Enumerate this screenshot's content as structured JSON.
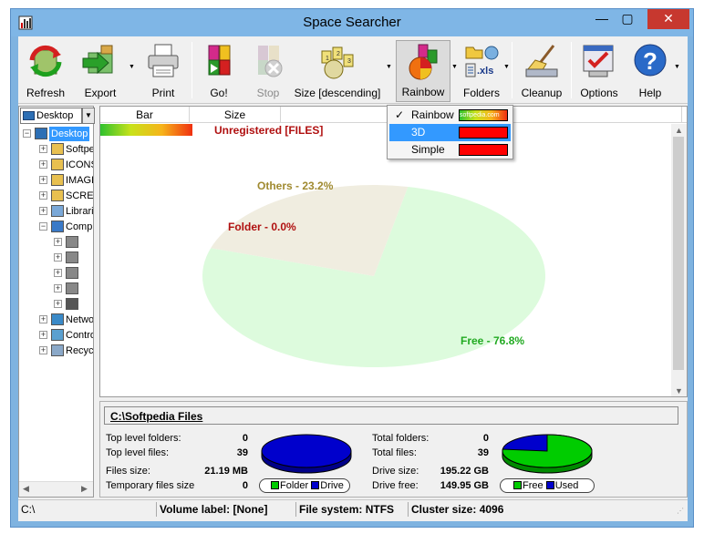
{
  "window": {
    "title": "Space Searcher"
  },
  "window_buttons": {
    "minimize": "—",
    "maximize": "▢",
    "close": "✕"
  },
  "toolbar": {
    "refresh": "Refresh",
    "export": "Export",
    "print": "Print",
    "go": "Go!",
    "stop": "Stop",
    "size": "Size [descending]",
    "rainbow": "Rainbow",
    "folders": "Folders",
    "cleanup": "Cleanup",
    "options": "Options",
    "help": "Help",
    "folders_icon_text": ".xls"
  },
  "left": {
    "drive_combo": "Desktop",
    "tree": [
      {
        "label": "Desktop",
        "indent": 0,
        "selected": true,
        "expander": "−"
      },
      {
        "label": "Softpedia",
        "indent": 1,
        "expander": "+"
      },
      {
        "label": "ICONS",
        "indent": 1,
        "expander": "+"
      },
      {
        "label": "IMAGES",
        "indent": 1,
        "expander": "+"
      },
      {
        "label": "SCREENSHOTS",
        "indent": 1,
        "expander": "+"
      },
      {
        "label": "Libraries",
        "indent": 1,
        "expander": "+"
      },
      {
        "label": "Computer",
        "indent": 1,
        "expander": "−"
      },
      {
        "label": "",
        "indent": 2,
        "expander": "+"
      },
      {
        "label": "",
        "indent": 2,
        "expander": "+"
      },
      {
        "label": "",
        "indent": 2,
        "expander": "+"
      },
      {
        "label": "",
        "indent": 2,
        "expander": "+"
      },
      {
        "label": "",
        "indent": 2,
        "expander": "+"
      },
      {
        "label": "Network",
        "indent": 1,
        "expander": "+"
      },
      {
        "label": "Control Panel",
        "indent": 1,
        "expander": "+"
      },
      {
        "label": "Recycle Bin",
        "indent": 1,
        "expander": "+"
      }
    ]
  },
  "columns": {
    "bar": "Bar",
    "size": "Size"
  },
  "unregistered": "Unregistered [FILES]",
  "pie": {
    "slices": [
      {
        "label": "Free - 76.8%",
        "value": 76.8,
        "color": "#ddfbdd",
        "text_color": "#22aa22"
      },
      {
        "label": "Others - 23.2%",
        "value": 23.2,
        "color": "#f0ede0",
        "text_color": "#a08a30"
      },
      {
        "label": "Folder - 0.0%",
        "value": 0.0,
        "color": "#b01010",
        "text_color": "#b01010"
      }
    ]
  },
  "menu": {
    "items": [
      {
        "label": "Rainbow",
        "checked": true,
        "check_glyph": "✓"
      },
      {
        "label": "3D",
        "checked": false,
        "highlighted": true
      },
      {
        "label": "Simple",
        "checked": false
      }
    ],
    "rainbow_swatch_text": "softpedia.com"
  },
  "details": {
    "path": "C:\\Softpedia Files",
    "left_stats": [
      {
        "label": "Top level folders:",
        "value": "0"
      },
      {
        "label": "Top level files:",
        "value": "39"
      },
      {
        "label": "Files size:",
        "value": "21.19 MB"
      },
      {
        "label": "Temporary files size",
        "value": "0"
      }
    ],
    "right_stats": [
      {
        "label": "Total folders:",
        "value": "0"
      },
      {
        "label": "Total files:",
        "value": "39"
      },
      {
        "label": "Drive size:",
        "value": "195.22 GB"
      },
      {
        "label": "Drive free:",
        "value": "149.95 GB"
      }
    ],
    "legend1": {
      "a": "Folder",
      "b": "Drive"
    },
    "legend2": {
      "a": "Free",
      "b": "Used"
    },
    "mini_pie_folder_share": 0.0,
    "mini_pie_free_share": 76.8
  },
  "colors": {
    "accent": "#3399ff",
    "folder": "#00cc00",
    "drive": "#0000cc",
    "free": "#00cc00",
    "used": "#0000cc"
  },
  "status": {
    "path": "C:\\",
    "volume": "Volume label: [None]",
    "fs": "File system: NTFS",
    "cluster": "Cluster size: 4096"
  }
}
